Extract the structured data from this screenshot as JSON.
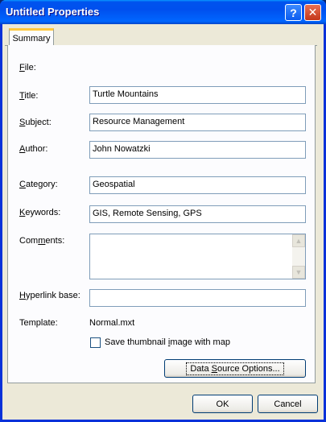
{
  "window": {
    "title": "Untitled Properties",
    "help_label": "?",
    "close_label": "✕"
  },
  "tabs": [
    {
      "label": "Summary",
      "selected": true
    }
  ],
  "form": {
    "file_label_u": "F",
    "file_label_rest": "ile:",
    "title_label_u": "T",
    "title_label_rest": "itle:",
    "title_value": "Turtle Mountains",
    "subject_label_u": "S",
    "subject_label_rest": "ubject:",
    "subject_value": "Resource Management",
    "author_label_u": "A",
    "author_label_rest": "uthor:",
    "author_value": "John Nowatzki",
    "category_label_u": "C",
    "category_label_rest": "ategory:",
    "category_value": "Geospatial",
    "keywords_label_u": "K",
    "keywords_label_rest": "eywords:",
    "keywords_value": "GIS, Remote Sensing, GPS",
    "comments_label_pre": "Com",
    "comments_label_u": "m",
    "comments_label_rest": "ents:",
    "comments_value": "",
    "hyperlink_label_u": "H",
    "hyperlink_label_rest": "yperlink base:",
    "hyperlink_value": "",
    "template_label": "Template:",
    "template_value": "Normal.mxt",
    "thumbnail_label_pre": "Save thumbnail ",
    "thumbnail_label_u": "i",
    "thumbnail_label_rest": "mage with map",
    "thumbnail_checked": false,
    "data_source_button_pre": "Data ",
    "data_source_button_u": "S",
    "data_source_button_rest": "ource Options..."
  },
  "footer": {
    "ok_label": "OK",
    "cancel_label": "Cancel"
  },
  "icons": {
    "scroll_up": "▲",
    "scroll_down": "▼"
  },
  "colors": {
    "titlebar": "#0053ee",
    "dialog_bg": "#ece9d8",
    "tab_accent": "#ffc83c",
    "close_button": "#c4361a"
  }
}
